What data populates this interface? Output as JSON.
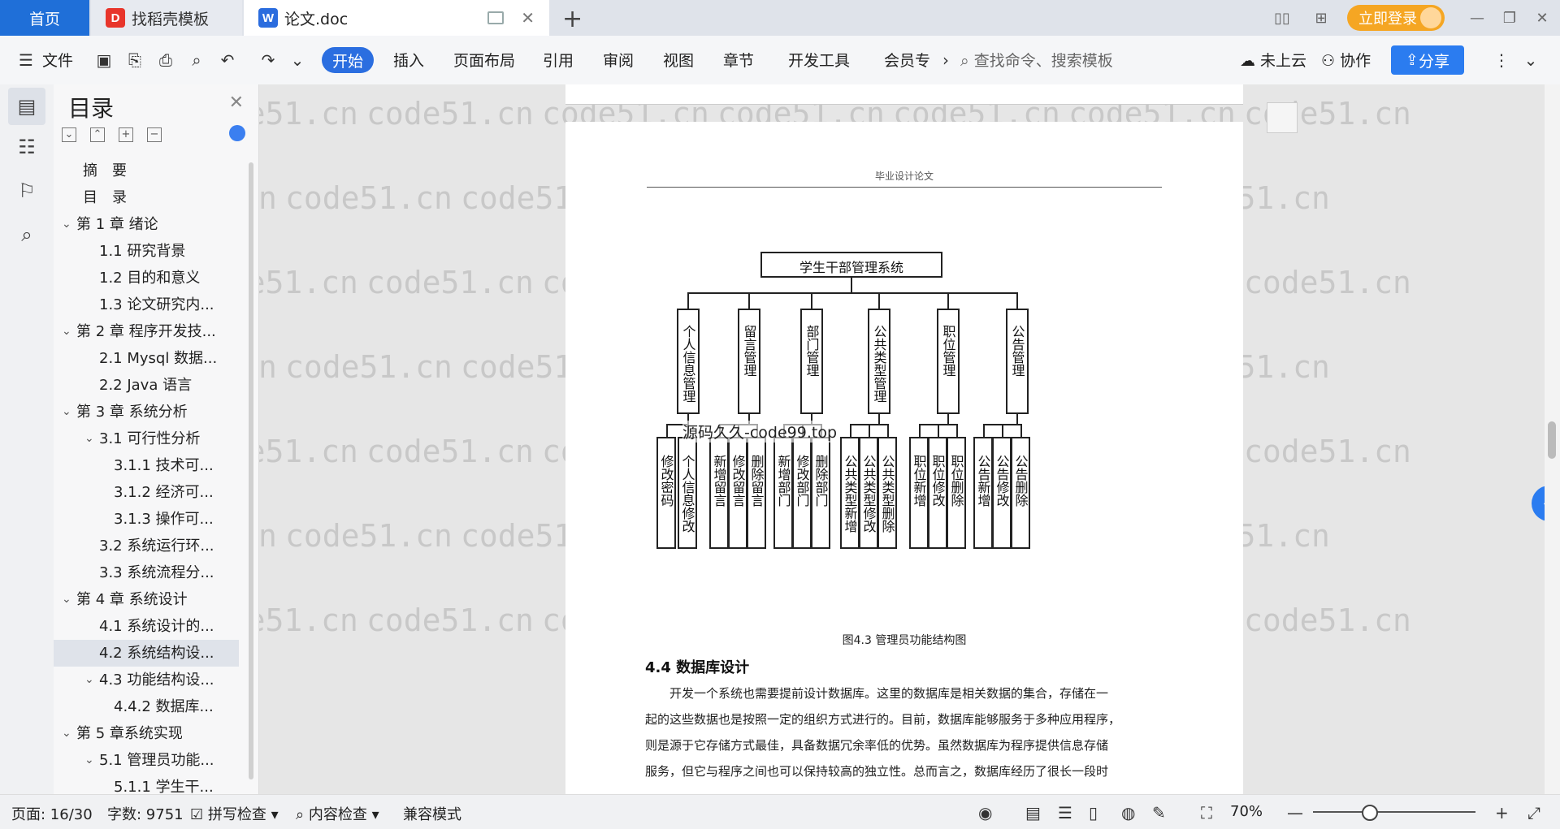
{
  "tabs": {
    "home": "首页",
    "docer": "找稻壳模板",
    "docer_icon": "docer-icon",
    "doc": "论文.doc",
    "doc_icon": "wps-writer-icon"
  },
  "titlebar": {
    "login": "立即登录"
  },
  "menu": {
    "file": "文件",
    "start": "开始",
    "insert": "插入",
    "layout": "页面布局",
    "reference": "引用",
    "review": "审阅",
    "view": "视图",
    "chapter": "章节",
    "devtools": "开发工具",
    "member": "会员专",
    "search_placeholder": "查找命令、搜索模板",
    "cloud": "未上云",
    "collab": "协作",
    "share": "分享"
  },
  "toc": {
    "title": "目录",
    "items": [
      {
        "label": "摘　要",
        "level": 1
      },
      {
        "label": "目　录",
        "level": 1
      },
      {
        "label": "第 1 章  绪论",
        "level": 0
      },
      {
        "label": "1.1  研究背景",
        "level": 2
      },
      {
        "label": "1.2 目的和意义",
        "level": 2
      },
      {
        "label": "1.3  论文研究内...",
        "level": 2
      },
      {
        "label": "第 2 章  程序开发技...",
        "level": 0
      },
      {
        "label": "2.1 Mysql 数据...",
        "level": 2
      },
      {
        "label": "2.2 Java 语言",
        "level": 2
      },
      {
        "label": "第 3 章  系统分析",
        "level": 0
      },
      {
        "label": "3.1 可行性分析",
        "level": 3
      },
      {
        "label": "3.1.1 技术可...",
        "level": 4
      },
      {
        "label": "3.1.2 经济可...",
        "level": 4
      },
      {
        "label": "3.1.3 操作可...",
        "level": 4
      },
      {
        "label": "3.2 系统运行环...",
        "level": 2
      },
      {
        "label": "3.3 系统流程分...",
        "level": 2
      },
      {
        "label": "第 4 章  系统设计",
        "level": 0
      },
      {
        "label": "4.1  系统设计的...",
        "level": 2
      },
      {
        "label": "4.2  系统结构设...",
        "level": 2
      },
      {
        "label": "4.3 功能结构设...",
        "level": 3
      },
      {
        "label": "4.4.2  数据库...",
        "level": 4
      },
      {
        "label": "第 5 章系统实现",
        "level": 0
      },
      {
        "label": "5.1 管理员功能...",
        "level": 3
      },
      {
        "label": "5.1.1  学生干...",
        "level": 4
      }
    ]
  },
  "document": {
    "header": "毕业设计论文",
    "watermark": "code51.cn",
    "overlay_text": "源码久久-code99.top",
    "chart_root": "学生干部管理系统",
    "modules": [
      {
        "name": "个人信息管理",
        "children": [
          "修改密码",
          "个人信息修改"
        ]
      },
      {
        "name": "留言管理",
        "children": [
          "新增留言",
          "修改留言",
          "删除留言"
        ]
      },
      {
        "name": "部门管理",
        "children": [
          "新增部门",
          "修改部门",
          "删除部门"
        ]
      },
      {
        "name": "公共类型管理",
        "children": [
          "公共类型新增",
          "公共类型修改",
          "公共类型删除"
        ]
      },
      {
        "name": "职位管理",
        "children": [
          "职位新增",
          "职位修改",
          "职位删除"
        ]
      },
      {
        "name": "公告管理",
        "children": [
          "公告新增",
          "公告修改",
          "公告删除"
        ]
      }
    ],
    "caption": "图4.3  管理员功能结构图",
    "section_title": "4.4  数据库设计",
    "paragraph": [
      "开发一个系统也需要提前设计数据库。这里的数据库是相关数据的集合，存储在一",
      "起的这些数据也是按照一定的组织方式进行的。目前，数据库能够服务于多种应用程序，",
      "则是源于它存储方式最佳，具备数据冗余率低的优势。虽然数据库为程序提供信息存储",
      "服务，但它与程序之间也可以保持较高的独立性。总而言之，数据库经历了很长一段时"
    ]
  },
  "status": {
    "page": "页面: 16/30",
    "words": "字数: 9751",
    "spell": "拼写检查",
    "content_check": "内容检查",
    "compat": "兼容模式",
    "zoom": "70%"
  }
}
